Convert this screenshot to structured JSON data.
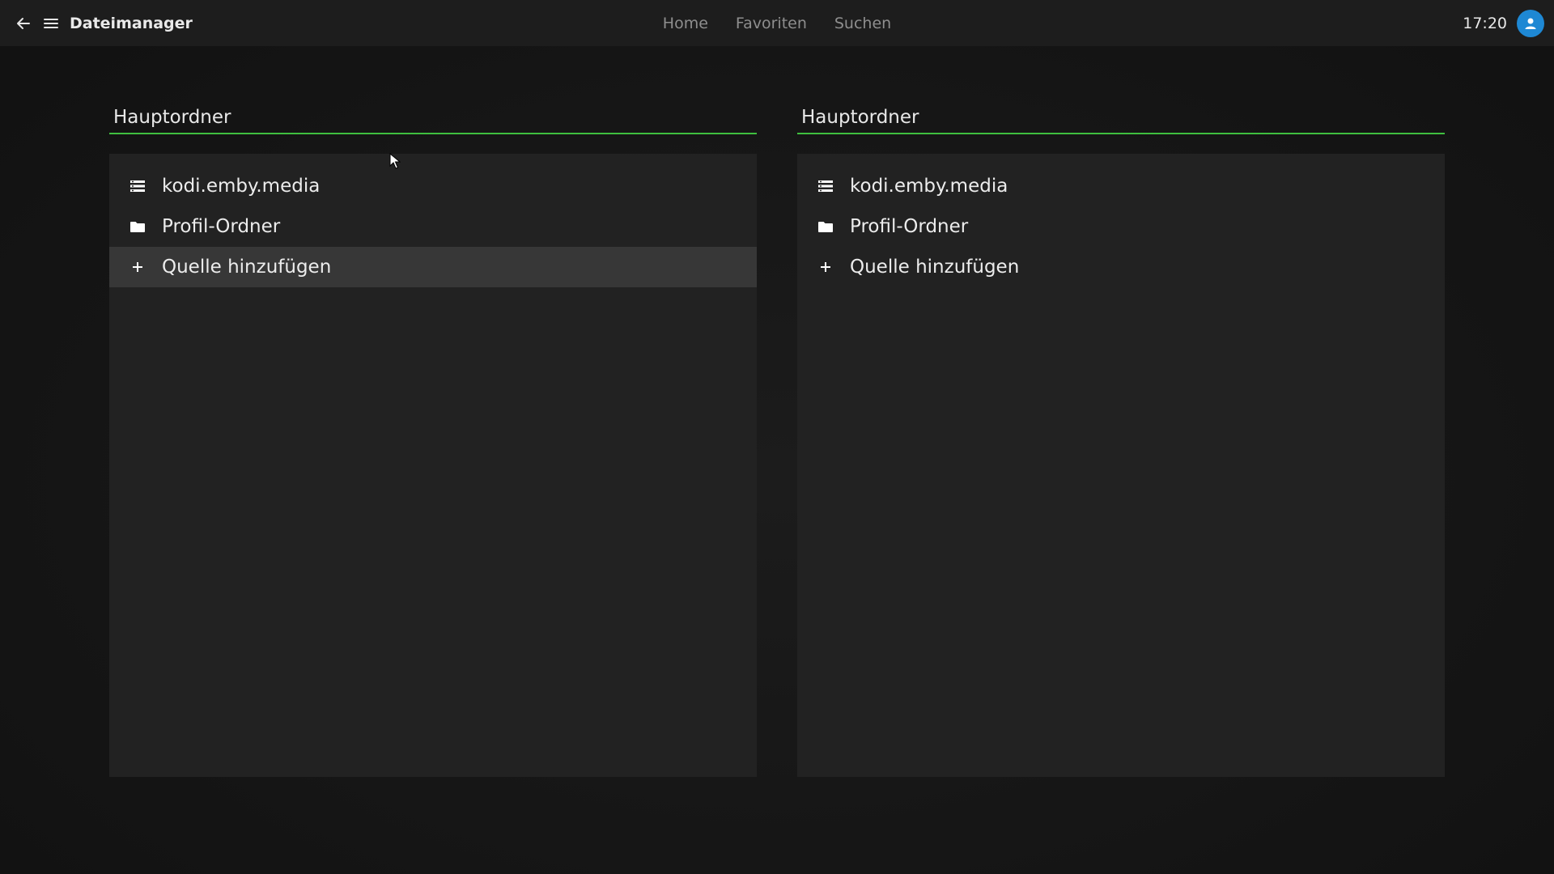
{
  "header": {
    "title": "Dateimanager",
    "nav": [
      "Home",
      "Favoriten",
      "Suchen"
    ],
    "clock": "17:20",
    "avatar_color": "#1e88d4"
  },
  "panels": [
    {
      "title": "Hauptordner",
      "items": [
        {
          "label": "kodi.emby.media",
          "icon": "server-icon"
        },
        {
          "label": "Profil-Ordner",
          "icon": "folder-icon"
        },
        {
          "label": "Quelle hinzufügen",
          "icon": "plus-icon"
        }
      ],
      "focused_index": 2
    },
    {
      "title": "Hauptordner",
      "items": [
        {
          "label": "kodi.emby.media",
          "icon": "server-icon"
        },
        {
          "label": "Profil-Ordner",
          "icon": "folder-icon"
        },
        {
          "label": "Quelle hinzufügen",
          "icon": "plus-icon"
        }
      ]
    }
  ],
  "colors": {
    "accent_underline": "#3fbf3f",
    "panel_bg": "#222222",
    "focus_bg": "#373737"
  }
}
